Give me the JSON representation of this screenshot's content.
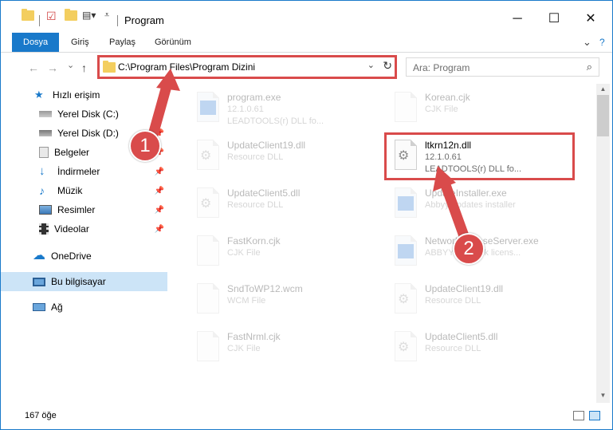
{
  "window": {
    "title": "Program",
    "minimize": "─",
    "maximize": "☐",
    "close": "✕"
  },
  "ribbon": {
    "tabs": [
      "Dosya",
      "Giriş",
      "Paylaş",
      "Görünüm"
    ],
    "expand": "⌄",
    "help": "?"
  },
  "nav": {
    "back": "←",
    "forward": "→",
    "recent": "⌄",
    "up": "↑",
    "address": "C:\\Program Files\\Program Dizini",
    "address_dropdown": "⌄",
    "refresh": "↻",
    "search_placeholder": "Ara: Program",
    "search_icon": "⌕"
  },
  "sidebar": {
    "items": [
      {
        "label": "Hızlı erişim",
        "icon": "star-icon"
      },
      {
        "label": "Yerel Disk (C:)",
        "icon": "drive-icon"
      },
      {
        "label": "Yerel Disk (D:)",
        "icon": "drive-icon"
      },
      {
        "label": "Belgeler",
        "icon": "documents-icon"
      },
      {
        "label": "İndirmeler",
        "icon": "download-icon"
      },
      {
        "label": "Müzik",
        "icon": "music-icon"
      },
      {
        "label": "Resimler",
        "icon": "pictures-icon"
      },
      {
        "label": "Videolar",
        "icon": "videos-icon"
      },
      {
        "label": "OneDrive",
        "icon": "cloud-icon"
      },
      {
        "label": "Bu bilgisayar",
        "icon": "computer-icon"
      },
      {
        "label": "Ağ",
        "icon": "network-icon"
      }
    ]
  },
  "files": [
    {
      "name": "program.exe",
      "line2": "12.1.0.61",
      "line3": "LEADTOOLS(r) DLL fo..."
    },
    {
      "name": "Korean.cjk",
      "line2": "CJK File",
      "line3": ""
    },
    {
      "name": "UpdateClient19.dll",
      "line2": "Resource DLL",
      "line3": ""
    },
    {
      "name": "ltkrn12n.dll",
      "line2": "12.1.0.61",
      "line3": "LEADTOOLS(r) DLL fo..."
    },
    {
      "name": "UpdateClient5.dll",
      "line2": "Resource DLL",
      "line3": ""
    },
    {
      "name": "UpdateInstaller.exe",
      "line2": "Abbyy updates installer",
      "line3": ""
    },
    {
      "name": "FastKorn.cjk",
      "line2": "CJK File",
      "line3": ""
    },
    {
      "name": "NetworkLicenseServer.exe",
      "line2": "ABBYY Network licens...",
      "line3": ""
    },
    {
      "name": "SndToWP12.wcm",
      "line2": "WCM File",
      "line3": ""
    },
    {
      "name": "UpdateClient19.dll",
      "line2": "Resource DLL",
      "line3": ""
    },
    {
      "name": "FastNrml.cjk",
      "line2": "CJK File",
      "line3": ""
    },
    {
      "name": "UpdateClient5.dll",
      "line2": "Resource DLL",
      "line3": ""
    }
  ],
  "status": {
    "count": "167 öğe"
  },
  "annotations": {
    "badge1": "1",
    "badge2": "2",
    "color": "#d94b4b"
  }
}
